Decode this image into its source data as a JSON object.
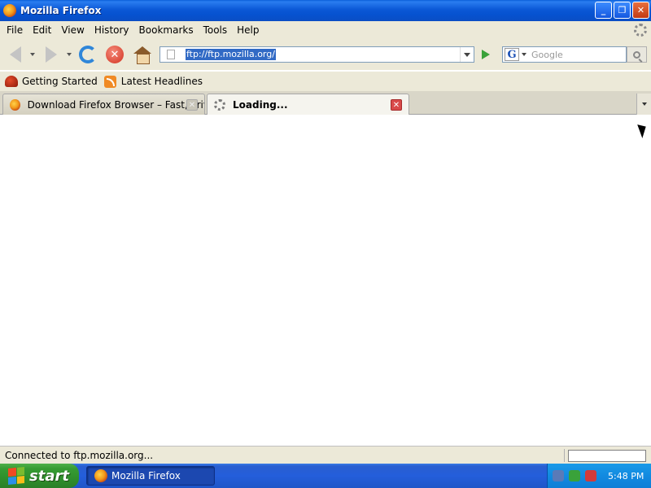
{
  "window": {
    "title": "Mozilla Firefox",
    "controls": {
      "minimize": "_",
      "restore": "❐",
      "close": "✕"
    }
  },
  "menu": {
    "items": [
      "File",
      "Edit",
      "View",
      "History",
      "Bookmarks",
      "Tools",
      "Help"
    ]
  },
  "navigation": {
    "url": "ftp://ftp.mozilla.org/",
    "search_placeholder": "Google",
    "search_engine_letter": "G",
    "stop_glyph": "✕"
  },
  "bookmarks": {
    "items": [
      "Getting Started",
      "Latest Headlines"
    ]
  },
  "tabs": [
    {
      "label": "Download Firefox Browser – Fast, Priva...",
      "close": "✕"
    },
    {
      "label": "Loading...",
      "close": "✕"
    }
  ],
  "status": {
    "text": "Connected to ftp.mozilla.org..."
  },
  "taskbar": {
    "start_label": "start",
    "task_label": "Mozilla Firefox",
    "clock": "5:48 PM"
  },
  "colors": {
    "win_logo": [
      "#f04a23",
      "#7cbb2f",
      "#2a8fe8",
      "#f8bd19"
    ],
    "tray_icons": [
      "#5a7ab8",
      "#3aa23a",
      "#d33a3a"
    ]
  }
}
